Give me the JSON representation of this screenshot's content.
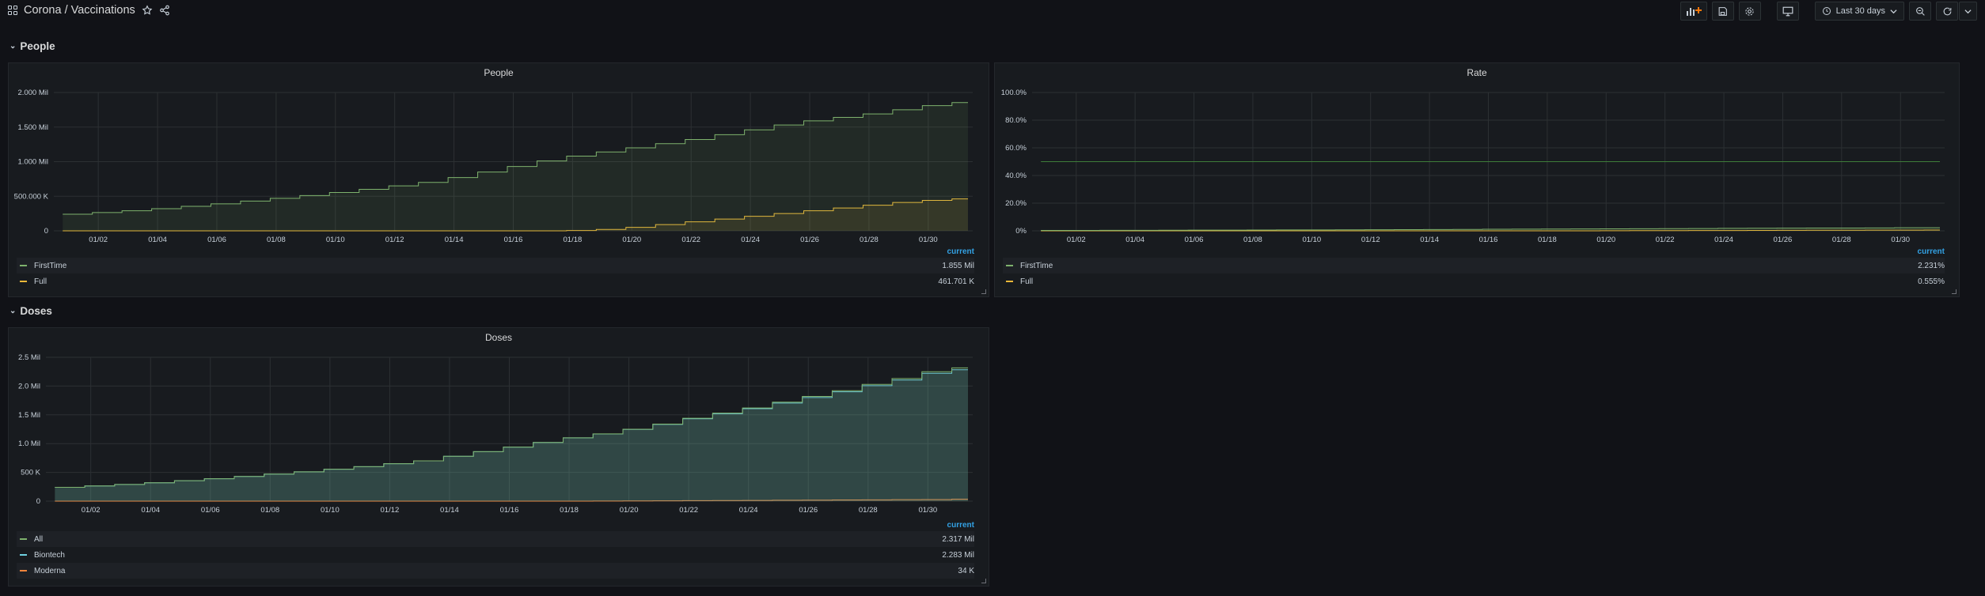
{
  "nav": {
    "folder": "Corona",
    "separator": "/",
    "dashboard": "Vaccinations",
    "title": "Corona / Vaccinations",
    "time_range": "Last 30 days"
  },
  "rows": [
    {
      "title": "People"
    },
    {
      "title": "Doses"
    }
  ],
  "legend_header": "current",
  "x_ticks": [
    "01/02",
    "01/04",
    "01/06",
    "01/08",
    "01/10",
    "01/12",
    "01/14",
    "01/16",
    "01/18",
    "01/20",
    "01/22",
    "01/24",
    "01/26",
    "01/28",
    "01/30"
  ],
  "panels": [
    {
      "title": "People",
      "y_ticks": [
        "2.000 Mil",
        "1.500 Mil",
        "1.000 Mil",
        "500.000 K",
        "0"
      ],
      "legend": [
        {
          "name": "FirstTime",
          "value": "1.855 Mil",
          "color": "#7eb26d"
        },
        {
          "name": "Full",
          "value": "461.701 K",
          "color": "#eab839"
        }
      ]
    },
    {
      "title": "Rate",
      "y_ticks": [
        "100.0%",
        "80.0%",
        "60.0%",
        "40.0%",
        "20.0%",
        "0%"
      ],
      "legend": [
        {
          "name": "FirstTime",
          "value": "2.231%",
          "color": "#7eb26d"
        },
        {
          "name": "Full",
          "value": "0.555%",
          "color": "#eab839"
        }
      ]
    },
    {
      "title": "Doses",
      "y_ticks": [
        "2.5 Mil",
        "2.0 Mil",
        "1.5 Mil",
        "1.0 Mil",
        "500 K",
        "0"
      ],
      "legend": [
        {
          "name": "All",
          "value": "2.317 Mil",
          "color": "#7eb26d"
        },
        {
          "name": "Biontech",
          "value": "2.283 Mil",
          "color": "#6ed0e0"
        },
        {
          "name": "Moderna",
          "value": "34 K",
          "color": "#ef843c"
        }
      ]
    }
  ],
  "chart_data": [
    {
      "type": "area",
      "title": "People",
      "x": [
        "12/31",
        "01/01",
        "01/02",
        "01/03",
        "01/04",
        "01/05",
        "01/06",
        "01/07",
        "01/08",
        "01/09",
        "01/10",
        "01/11",
        "01/12",
        "01/13",
        "01/14",
        "01/15",
        "01/16",
        "01/17",
        "01/18",
        "01/19",
        "01/20",
        "01/21",
        "01/22",
        "01/23",
        "01/24",
        "01/25",
        "01/26",
        "01/27",
        "01/28",
        "01/29",
        "01/30",
        "01/31"
      ],
      "ylim": [
        0,
        2000000
      ],
      "series": [
        {
          "name": "FirstTime",
          "color": "#7eb26d",
          "values": [
            210000,
            240000,
            265000,
            290000,
            320000,
            355000,
            390000,
            430000,
            470000,
            510000,
            555000,
            600000,
            650000,
            700000,
            770000,
            850000,
            930000,
            1010000,
            1080000,
            1140000,
            1200000,
            1260000,
            1320000,
            1390000,
            1460000,
            1530000,
            1590000,
            1640000,
            1690000,
            1750000,
            1810000,
            1855000
          ]
        },
        {
          "name": "Full",
          "color": "#eab839",
          "values": [
            0,
            0,
            0,
            0,
            0,
            0,
            0,
            0,
            0,
            0,
            0,
            0,
            0,
            0,
            0,
            0,
            0,
            0,
            5000,
            20000,
            50000,
            90000,
            130000,
            170000,
            210000,
            250000,
            290000,
            330000,
            370000,
            410000,
            440000,
            461701
          ]
        }
      ]
    },
    {
      "type": "line",
      "title": "Rate",
      "x": [
        "12/31",
        "01/01",
        "01/02",
        "01/03",
        "01/04",
        "01/05",
        "01/06",
        "01/07",
        "01/08",
        "01/09",
        "01/10",
        "01/11",
        "01/12",
        "01/13",
        "01/14",
        "01/15",
        "01/16",
        "01/17",
        "01/18",
        "01/19",
        "01/20",
        "01/21",
        "01/22",
        "01/23",
        "01/24",
        "01/25",
        "01/26",
        "01/27",
        "01/28",
        "01/29",
        "01/30",
        "01/31"
      ],
      "ylim": [
        0,
        100
      ],
      "series": [
        {
          "name": "FirstTime",
          "color": "#7eb26d",
          "values": [
            0.25,
            0.29,
            0.32,
            0.35,
            0.39,
            0.43,
            0.47,
            0.52,
            0.57,
            0.61,
            0.67,
            0.72,
            0.78,
            0.84,
            0.93,
            1.02,
            1.12,
            1.21,
            1.3,
            1.37,
            1.44,
            1.51,
            1.59,
            1.67,
            1.76,
            1.84,
            1.91,
            1.97,
            2.03,
            2.1,
            2.18,
            2.231
          ]
        },
        {
          "name": "Full",
          "color": "#eab839",
          "values": [
            0,
            0,
            0,
            0,
            0,
            0,
            0,
            0,
            0,
            0,
            0,
            0,
            0,
            0,
            0,
            0,
            0,
            0,
            0.01,
            0.02,
            0.06,
            0.11,
            0.16,
            0.2,
            0.25,
            0.3,
            0.35,
            0.4,
            0.44,
            0.49,
            0.53,
            0.555
          ]
        },
        {
          "name": "",
          "color": "#3f7d3a",
          "values": [
            50,
            50,
            50,
            50,
            50,
            50,
            50,
            50,
            50,
            50,
            50,
            50,
            50,
            50,
            50,
            50,
            50,
            50,
            50,
            50,
            50,
            50,
            50,
            50,
            50,
            50,
            50,
            50,
            50,
            50,
            50,
            50
          ]
        }
      ]
    },
    {
      "type": "area",
      "title": "Doses",
      "x": [
        "12/31",
        "01/01",
        "01/02",
        "01/03",
        "01/04",
        "01/05",
        "01/06",
        "01/07",
        "01/08",
        "01/09",
        "01/10",
        "01/11",
        "01/12",
        "01/13",
        "01/14",
        "01/15",
        "01/16",
        "01/17",
        "01/18",
        "01/19",
        "01/20",
        "01/21",
        "01/22",
        "01/23",
        "01/24",
        "01/25",
        "01/26",
        "01/27",
        "01/28",
        "01/29",
        "01/30",
        "01/31"
      ],
      "ylim": [
        0,
        2500000
      ],
      "series": [
        {
          "name": "All",
          "color": "#7eb26d",
          "values": [
            210000,
            240000,
            265000,
            290000,
            320000,
            355000,
            390000,
            430000,
            470000,
            510000,
            555000,
            600000,
            650000,
            700000,
            780000,
            860000,
            940000,
            1020000,
            1100000,
            1170000,
            1250000,
            1340000,
            1440000,
            1530000,
            1620000,
            1720000,
            1820000,
            1920000,
            2030000,
            2130000,
            2250000,
            2317000
          ]
        },
        {
          "name": "Biontech",
          "color": "#6ed0e0",
          "values": [
            210000,
            240000,
            265000,
            290000,
            320000,
            355000,
            390000,
            430000,
            470000,
            510000,
            555000,
            600000,
            650000,
            700000,
            780000,
            860000,
            940000,
            1020000,
            1100000,
            1168000,
            1246000,
            1334000,
            1432000,
            1520000,
            1608000,
            1705000,
            1802000,
            1900000,
            2008000,
            2105000,
            2222000,
            2283000
          ]
        },
        {
          "name": "Moderna",
          "color": "#ef843c",
          "values": [
            0,
            0,
            0,
            0,
            0,
            0,
            0,
            0,
            0,
            0,
            0,
            0,
            0,
            0,
            0,
            0,
            0,
            0,
            0,
            2000,
            4000,
            6000,
            8000,
            10000,
            12000,
            15000,
            18000,
            20000,
            22000,
            25000,
            28000,
            34000
          ]
        }
      ]
    }
  ]
}
